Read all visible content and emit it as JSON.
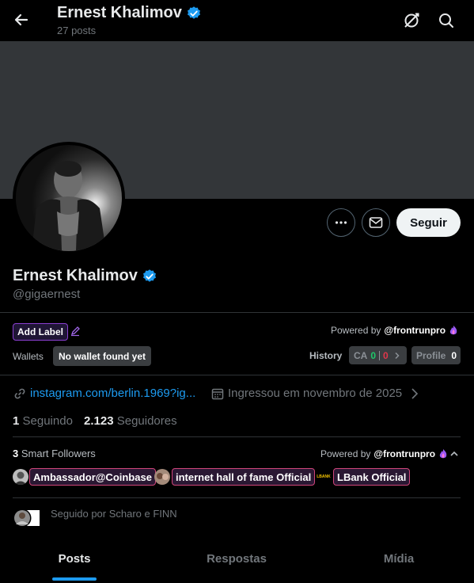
{
  "header": {
    "name": "Ernest Khalimov",
    "posts_count": "27 posts",
    "back_icon": "arrow-left-icon",
    "extension_icon": "frontrun-extension-icon",
    "search_icon": "search-icon"
  },
  "profile": {
    "name": "Ernest Khalimov",
    "handle": "@gigaernest",
    "verified": true,
    "verified_color": "#1d9bf0",
    "follow_label": "Seguir",
    "more_icon": "more-icon",
    "message_icon": "mail-icon"
  },
  "frontrun": {
    "add_label": "Add Label",
    "powered_by": "Powered by",
    "brand": "@frontrunpro",
    "wallets_label": "Wallets",
    "wallet_status": "No wallet found yet",
    "history_label": "History",
    "ca_label": "CA",
    "ca_green": "0",
    "ca_red": "0",
    "profile_label": "Profile",
    "profile_count": "0"
  },
  "info": {
    "link": "instagram.com/berlin.1969?ig...",
    "joined": "Ingressou em novembro de 2025"
  },
  "stats": {
    "following_count": "1",
    "following_label": "Seguindo",
    "followers_count": "2.123",
    "followers_label": "Seguidores"
  },
  "smart_followers": {
    "count": "3",
    "label": "Smart Followers",
    "powered_by": "Powered by",
    "brand": "@frontrunpro",
    "items": [
      {
        "name": "Ambassador@Coinbase"
      },
      {
        "name": "internet hall of fame Official"
      },
      {
        "name": "LBank Official",
        "logo_text": "LBANK"
      }
    ]
  },
  "followed_by": "Seguido por Scharo e FINN",
  "tabs": {
    "posts": "Posts",
    "replies": "Respostas",
    "media": "Mídia",
    "active": "posts"
  }
}
